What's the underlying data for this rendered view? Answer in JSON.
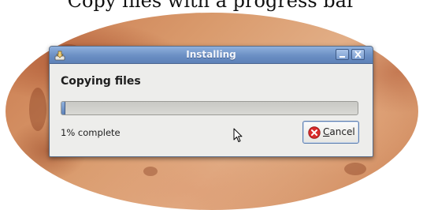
{
  "caption": {
    "text": "Copy files with a progress bar"
  },
  "window": {
    "title": "Installing",
    "heading": "Copying files",
    "progress": {
      "percent": 1,
      "status_text": "1% complete"
    },
    "cancel_button": {
      "mnemonic": "C",
      "rest": "ancel",
      "icon": "cancel-icon"
    },
    "titlebar_icons": [
      "app-icon",
      "minimize-icon",
      "close-icon"
    ]
  },
  "colors": {
    "titlebar": "#6b8fc4",
    "progress_fill": "#5d81b7",
    "cancel_icon": "#d92b2b",
    "wallpaper": "#d99a6c"
  }
}
